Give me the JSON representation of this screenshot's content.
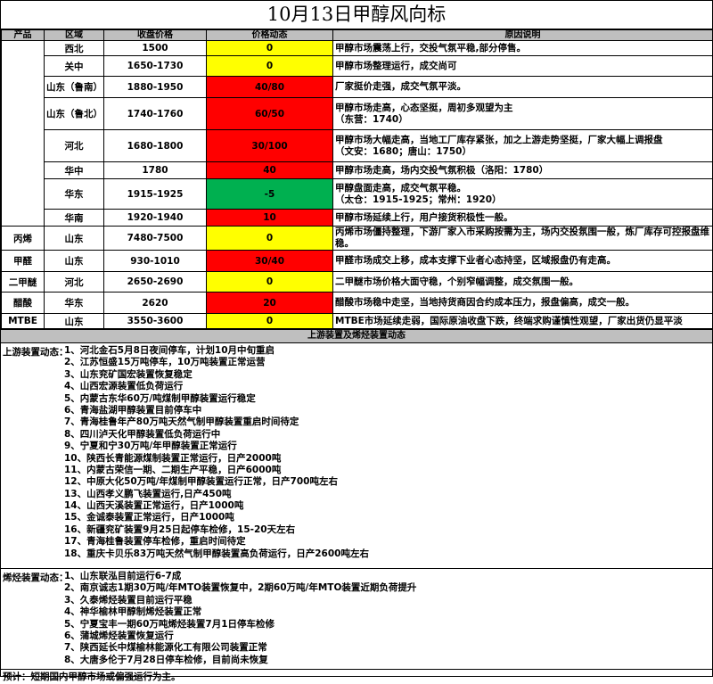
{
  "title": "10月13日甲醇风向标",
  "table": {
    "headers": [
      "产品",
      "区域",
      "收盘价格",
      "价格动态",
      "原因说明"
    ],
    "rows": [
      {
        "product": "",
        "region": "西北",
        "price": "1500",
        "change": "0",
        "color": "yellow",
        "note": "甲醇市场震荡上行，交投气氛平稳,部分停售。"
      },
      {
        "product": "",
        "region": "关中",
        "price": "1650-1730",
        "change": "0",
        "color": "yellow",
        "note": "甲醇市场整理运行，成交尚可"
      },
      {
        "product": "",
        "region": "山东（鲁南）",
        "price": "1880-1950",
        "change": "40/80",
        "color": "red",
        "note": "厂家挺价走强，成交气氛平淡。"
      },
      {
        "product": "",
        "region": "山东（鲁北）",
        "price": "1740-1760",
        "change": "60/50",
        "color": "red",
        "note": "甲醇市场走高，心态坚挺，周初多观望为主\n（东营：1740）"
      },
      {
        "product": "",
        "region": "河北",
        "price": "1680-1800",
        "change": "30/100",
        "color": "red",
        "note": "甲醇市场大幅走高，当地工厂库存紧张，加之上游走势坚挺，厂家大幅上调报盘\n（文安：1680；唐山：1750）"
      },
      {
        "product": "",
        "region": "华中",
        "price": "1780",
        "change": "40",
        "color": "red",
        "note": "甲醇市场走高，场内交投气氛积极（洛阳：1780）"
      },
      {
        "product": "",
        "region": "华东",
        "price": "1915-1925",
        "change": "-5",
        "color": "green",
        "note": "甲醇盘面走高，成交气氛平稳。\n（太仓：1915-1925；常州：1920）"
      },
      {
        "product": "",
        "region": "华南",
        "price": "1920-1940",
        "change": "10",
        "color": "red",
        "note": "甲醇市场延续上行，用户接货积极性一般。"
      },
      {
        "product": "丙烯",
        "region": "山东",
        "price": "7480-7500",
        "change": "0",
        "color": "yellow",
        "note": "丙烯市场僵持整理，下游厂家入市采购按需为主，场内交投氛围一般，炼厂库存可控报盘维稳。"
      },
      {
        "product": "甲醛",
        "region": "山东",
        "price": "930-1010",
        "change": "30/40",
        "color": "red",
        "note": "甲醛市场成交上移，成本支撑下业者心态持坚，区域报盘仍有走高。"
      },
      {
        "product": "二甲醚",
        "region": "河北",
        "price": "2650-2690",
        "change": "0",
        "color": "yellow",
        "note": "二甲醚市场价格大面守稳，个别窄幅调整，成交氛围一般。"
      },
      {
        "product": "醋酸",
        "region": "华东",
        "price": "2620",
        "change": "20",
        "color": "red",
        "note": "醋酸市场稳中走坚，当地持货商因合约成本压力，报盘偏高，成交一般。"
      },
      {
        "product": "MTBE",
        "region": "山东",
        "price": "3550-3600",
        "change": "0",
        "color": "yellow",
        "note": "MTBE市场延续走弱，国际原油收盘下跌，终端求购谨慎性观望，厂家出货仍显平淡"
      }
    ]
  },
  "upstream": {
    "section_title": "上游装置及烯烃装置动态",
    "lead": "上游装置动态：",
    "items": [
      "1、河北金石5月8日夜间停车，计划10月中旬重启",
      "2、江苏恒盛15万吨停车，10万吨装置正常运营",
      "3、山东兖矿国宏装置恢复稳定",
      "4、山西宏源装置低负荷运行",
      "5、内蒙古东华60万/吨煤制甲醇装置运行稳定",
      "6、青海盐湖甲醇装置目前停车中",
      "7、青海桂鲁年产80万吨天然气制甲醇装置重启时间待定",
      "8、四川泸天化甲醇装置低负荷运行中",
      "9、宁夏和宁30万吨/年甲醇装置正常运行",
      "10、陕西长青能源煤制装置正常运行，日产2000吨",
      "11、内蒙古荣信一期、二期生产平稳，日产6000吨",
      "12、中原大化50万吨/年煤制甲醇装置运行正常，日产700吨左右",
      "13、山西孝义鹏飞装置运行,日产450吨",
      "14、山西天溪装置正常运行，日产1000吨",
      "15、金诚泰装置正常运行，日产1000吨",
      "16、新疆兖矿装置9月25日起停车检修，15-20天左右",
      "17、青海桂鲁装置停车检修，重启时间待定",
      "18、重庆卡贝乐83万吨天然气制甲醇装置高负荷运行，日产2600吨左右"
    ]
  },
  "olefin": {
    "lead": "烯烃装置动态：",
    "items": [
      "1、山东联泓目前运行6-7成",
      "2、南京诚志1期30万吨/年MTO装置恢复中，2期60万吨/年MTO装置近期负荷提升",
      "3、久泰烯烃装置目前运行平稳",
      "4、神华榆林甲醇制烯烃装置正常",
      "5、宁夏宝丰一期60万吨烯烃装置7月1日停车检修",
      "6、蒲城烯烃装置恢复运行",
      "7、陕西延长中煤榆林能源化工有限公司装置正常",
      "8、大唐多伦于7月28日停车检修，目前尚未恢复"
    ]
  },
  "forecast": "预计：短期国内甲醇市场或偏强运行为主。",
  "colors": {
    "yellow": "#ffff00",
    "red": "#ff0000",
    "green": "#00b050",
    "header_gray": "#bfbfbf"
  }
}
